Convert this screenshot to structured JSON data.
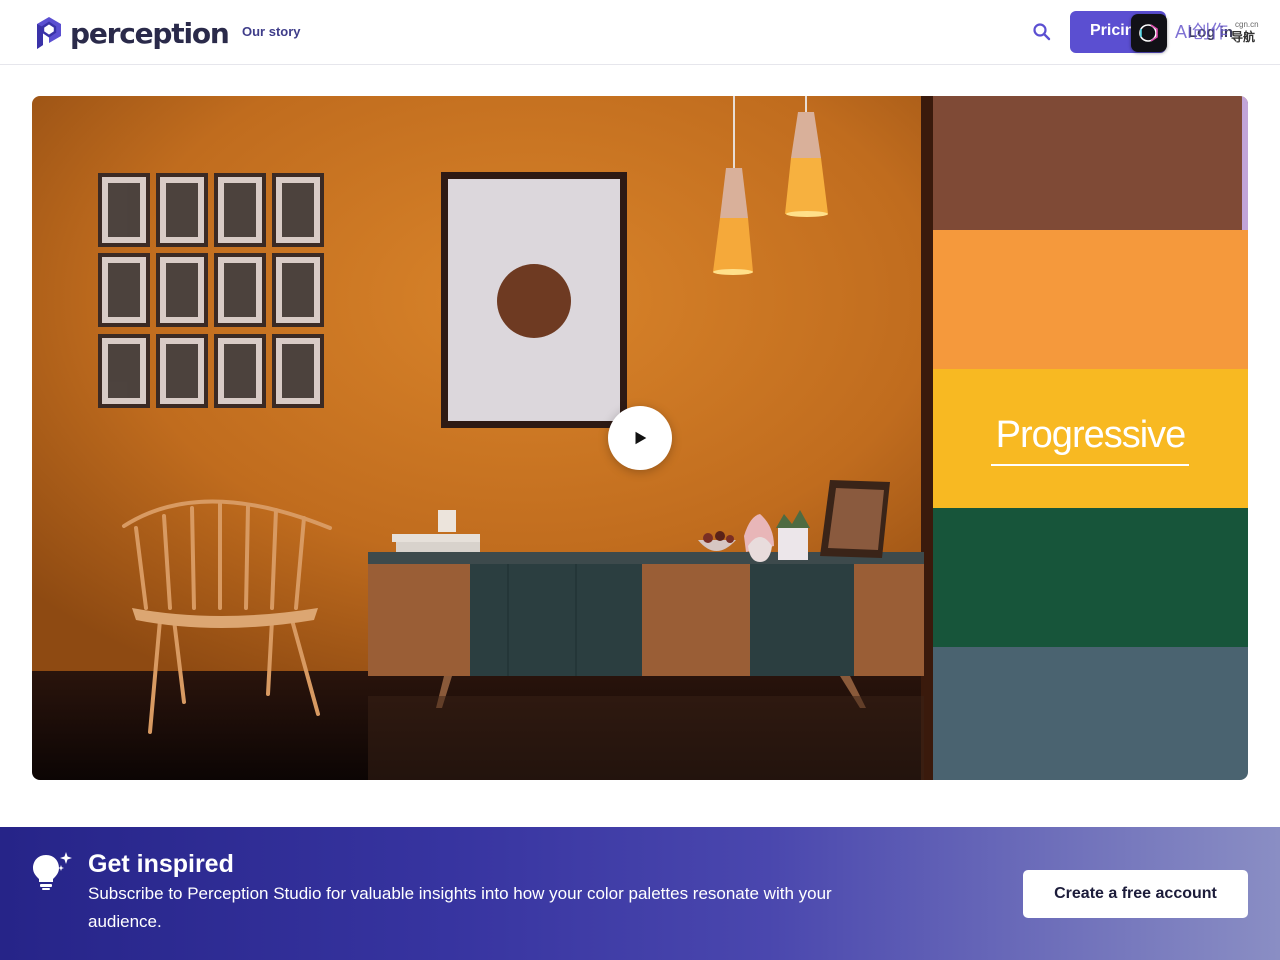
{
  "brand": {
    "name": "perception",
    "color": "#5b4fd1"
  },
  "nav": {
    "our_story": "Our story",
    "search_icon": "search-icon",
    "pricing": "Pricing",
    "login": "Log in"
  },
  "overlay_badge": {
    "text": "AI创作",
    "small_text": "cgn.cn",
    "sub_text": "导航"
  },
  "hero": {
    "play_icon": "play-icon",
    "palette_label": "Progressive",
    "swatches": [
      "#7f4a36",
      "#f5993c",
      "#f8b922",
      "#17553a",
      "#4a6370"
    ]
  },
  "banner": {
    "icon": "lightbulb-icon",
    "title": "Get inspired",
    "text": "Subscribe to Perception Studio for valuable insights into how your color palettes resonate with your audience.",
    "cta": "Create a free account"
  }
}
